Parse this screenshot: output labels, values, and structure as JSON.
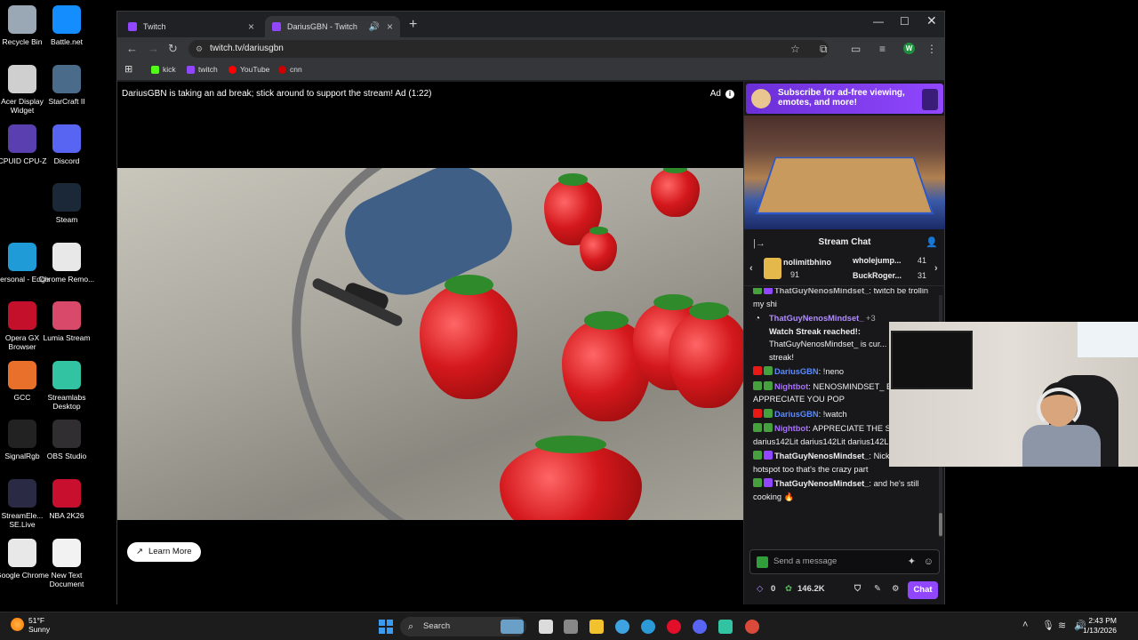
{
  "desktop_icons": [
    {
      "label": "Recycle Bin",
      "icon": "recycle-bin-icon",
      "color": "#9aa7b5"
    },
    {
      "label": "Battle.net",
      "icon": "battlenet-icon",
      "color": "#148eff"
    },
    {
      "label": "Acer Display Widget",
      "icon": "acer-icon",
      "color": "#cfcfcf"
    },
    {
      "label": "StarCraft II",
      "icon": "starcraft-icon",
      "color": "#4a6b8a"
    },
    {
      "label": "CPUID CPU-Z",
      "icon": "cpuz-icon",
      "color": "#5a3fb0"
    },
    {
      "label": "Discord",
      "icon": "discord-icon",
      "color": "#5865f2"
    },
    {
      "label": "Steam",
      "icon": "steam-icon",
      "color": "#1b2838"
    },
    {
      "label": "Personal - Edge",
      "icon": "edge-icon",
      "color": "#1f9bd7"
    },
    {
      "label": "Chrome Remo...",
      "icon": "chrome-remote-icon",
      "color": "#e8e8e8"
    },
    {
      "label": "Opera GX Browser",
      "icon": "opera-gx-icon",
      "color": "#c4102a"
    },
    {
      "label": "Lumia Stream",
      "icon": "lumia-icon",
      "color": "#d94a6a"
    },
    {
      "label": "GCC",
      "icon": "gcc-icon",
      "color": "#e8702a"
    },
    {
      "label": "Streamlabs Desktop",
      "icon": "streamlabs-icon",
      "color": "#31c3a2"
    },
    {
      "label": "SignalRgb",
      "icon": "signalrgb-icon",
      "color": "#222"
    },
    {
      "label": "OBS Studio",
      "icon": "obs-icon",
      "color": "#302e31"
    },
    {
      "label": "StreamEle... SE.Live",
      "icon": "streamelements-icon",
      "color": "#2a2a45"
    },
    {
      "label": "NBA 2K26",
      "icon": "nba2k-icon",
      "color": "#c8102e"
    },
    {
      "label": "Google Chrome",
      "icon": "chrome-icon",
      "color": "#e8e8e8"
    },
    {
      "label": "New Text Document",
      "icon": "text-document-icon",
      "color": "#f2f2f2"
    }
  ],
  "browser": {
    "tabs": [
      {
        "label": "Twitch"
      },
      {
        "label": "DariusGBN - Twitch"
      }
    ],
    "url": "twitch.tv/dariusgbn",
    "bookmarks": [
      {
        "label": "kick",
        "color": "#53fc18"
      },
      {
        "label": "twitch",
        "color": "#9146ff"
      },
      {
        "label": "YouTube",
        "color": "#ff0000"
      },
      {
        "label": "cnn",
        "color": "#cc0000"
      }
    ],
    "profile_initial": "W"
  },
  "player": {
    "ad_text": "DariusGBN is taking an ad break; stick around to support the stream! Ad (1:22)",
    "ad_label": "Ad",
    "learn_more": "Learn More"
  },
  "side": {
    "promo": "Subscribe for ad-free viewing, emotes, and more!",
    "chat_title": "Stream Chat",
    "gifters": [
      {
        "name": "nolimitbhino",
        "count": "91"
      },
      {
        "name": "wholejump...",
        "count": "41"
      },
      {
        "name": "BuckRoger...",
        "count": "31"
      }
    ],
    "messages": [
      {
        "user": "ThatGuyNenosMindset_",
        "text": ": twitch be trollin my shi",
        "badge": "green"
      },
      {
        "user": "ThatGuyNenosMindset_",
        "text": "+3",
        "badge": "streak"
      },
      {
        "user": "DariusGBN",
        "text": ": !neno",
        "badge": "red"
      },
      {
        "user": "Nightbot",
        "text": ": NENOSMINDSET_ BUILDING!! APPRECIATE YOU POP",
        "badge": "green"
      },
      {
        "user": "DariusGBN",
        "text": ": !watch",
        "badge": "red"
      },
      {
        "user": "Nightbot",
        "text": ": APPRECIATE THE STREAK darius142Lit darius142Lit darius142Lit",
        "badge": "green"
      },
      {
        "user": "ThatGuyNenosMindset_",
        "text": ": Nick playing on hotspot too that's the crazy part",
        "badge": "green"
      },
      {
        "user": "ThatGuyNenosMindset_",
        "text": ": and he's still cooking 🔥",
        "badge": "green"
      }
    ],
    "streak_title": "Watch Streak reached!:",
    "streak_body": "ThatGuyNenosMindset_ is cur... a 3-stream streak!",
    "input_placeholder": "Send a message",
    "points_a": "0",
    "points_b": "146.2K",
    "chat_button": "Chat"
  },
  "taskbar": {
    "temp": "51°F",
    "weather": "Sunny",
    "search": "Search",
    "time": "2:43 PM",
    "date": "1/13/2026"
  }
}
